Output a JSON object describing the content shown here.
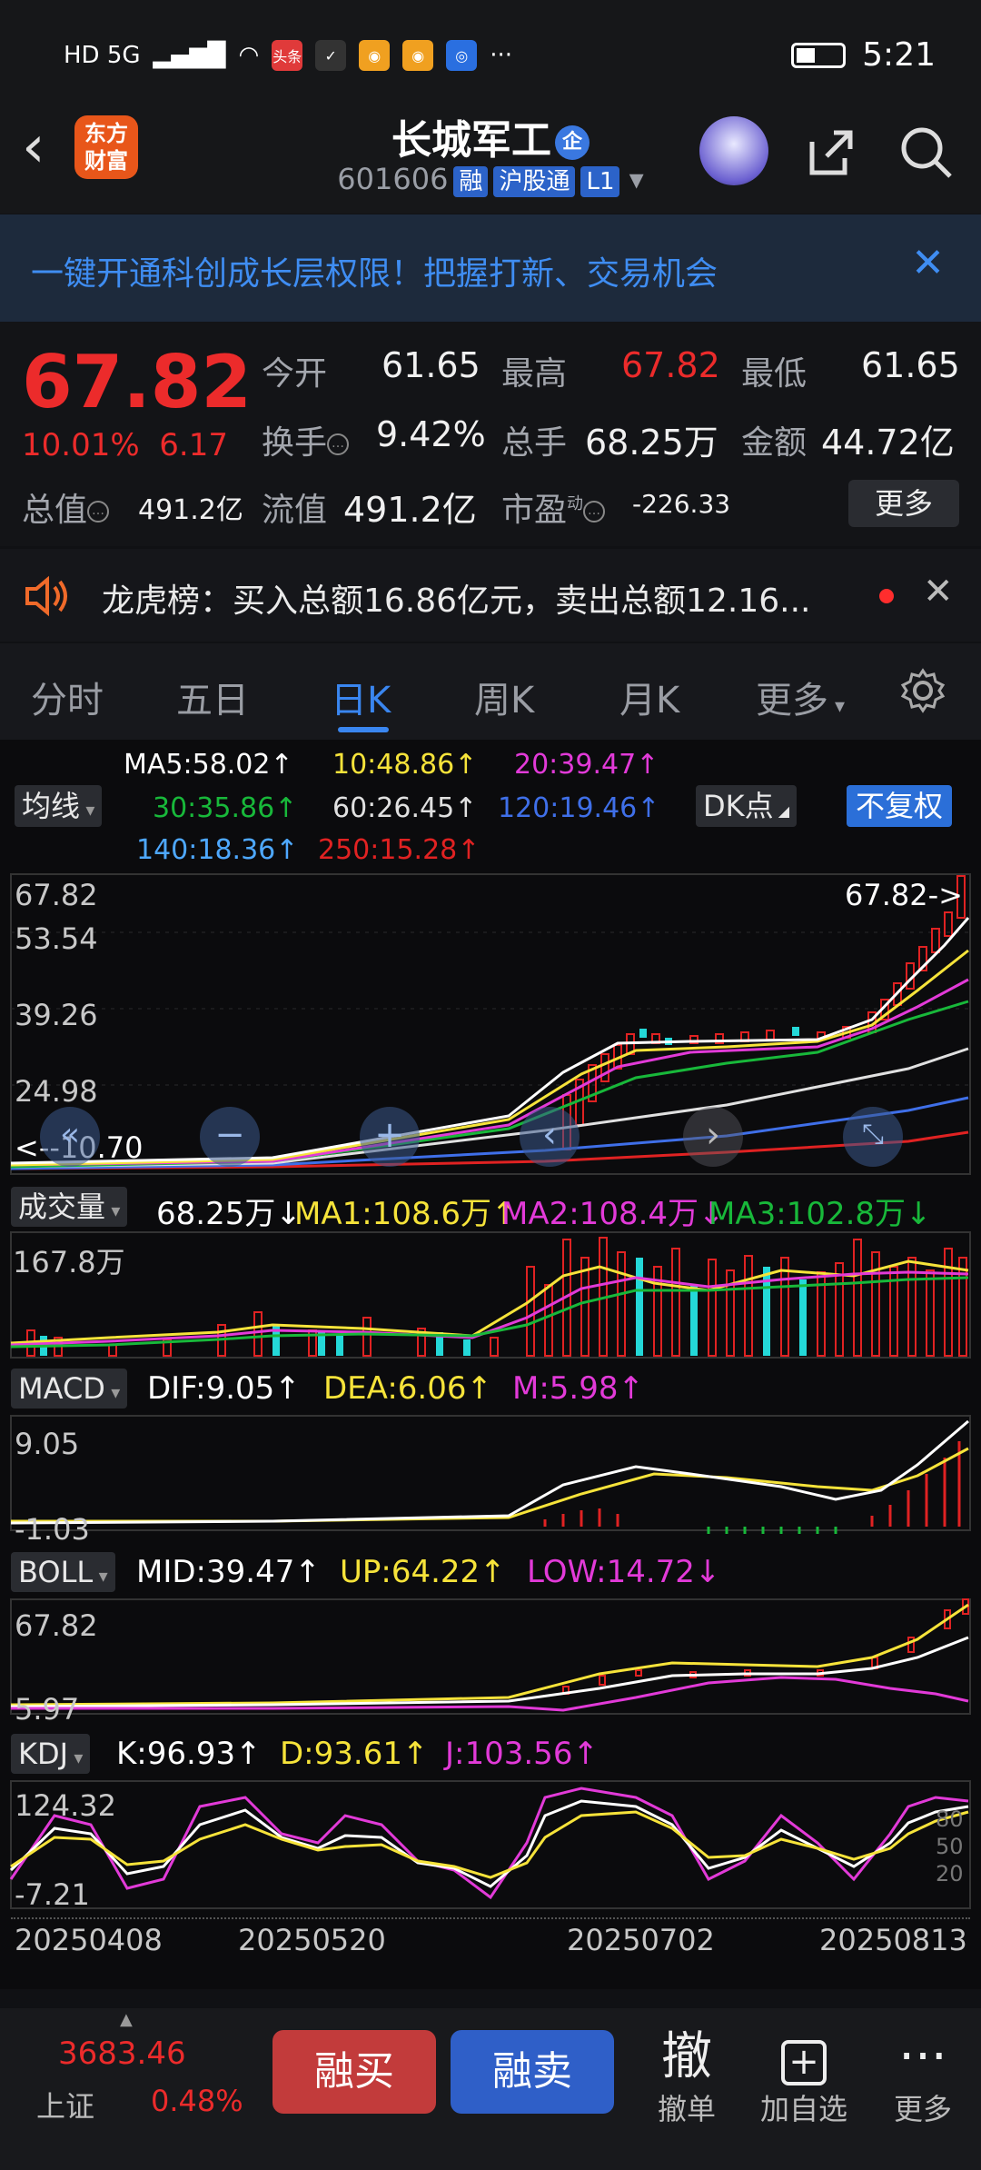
{
  "status_bar": {
    "network": "HD 5G",
    "time": "5:21",
    "more": "···",
    "app_badge": "头条"
  },
  "header": {
    "logo": "东方财富",
    "title": "长城军工",
    "title_badge": "企",
    "code": "601606",
    "tags": [
      "融",
      "沪股通",
      "L1"
    ]
  },
  "banner": {
    "text": "一键开通科创成长层权限！把握打新、交易机会",
    "close": "✕"
  },
  "quote": {
    "price": "67.82",
    "change_pct": "10.01%",
    "change": "6.17",
    "open_label": "今开",
    "open": "61.65",
    "high_label": "最高",
    "high": "67.82",
    "low_label": "最低",
    "low": "61.65",
    "turnover_label": "换手",
    "turnover": "9.42%",
    "volume_label": "总手",
    "volume": "68.25万",
    "amount_label": "金额",
    "amount": "44.72亿",
    "mcap_label": "总值",
    "mcap": "491.2亿",
    "float_label": "流值",
    "float": "491.2亿",
    "pe_label": "市盈",
    "pe_sup": "动",
    "pe": "-226.33",
    "more": "更多"
  },
  "notice": {
    "text": "龙虎榜：买入总额16.86亿元，卖出总额12.16...",
    "close": "✕"
  },
  "tabs": {
    "items": [
      "分时",
      "五日",
      "日K",
      "周K",
      "月K",
      "更多"
    ],
    "active": 2
  },
  "ma": {
    "selector": "均线",
    "ma5": "MA5:58.02↑",
    "ma10": "10:48.86↑",
    "ma20": "20:39.47↑",
    "ma30": "30:35.86↑",
    "ma60": "60:26.45↑",
    "ma120": "120:19.46↑",
    "ma140": "140:18.36↑",
    "ma250": "250:15.28↑",
    "dk_button": "DK点",
    "adjust_button": "不复权"
  },
  "kline": {
    "y_labels": [
      "67.82",
      "53.54",
      "39.26",
      "24.98",
      "10.70"
    ],
    "latest_label": "67.82->",
    "low_label": "<--10.70",
    "colors": {
      "ma5": "#ffffff",
      "ma10": "#f6e33a",
      "ma20": "#e23ad8",
      "ma30": "#18b83a",
      "ma60": "#e0e0e0",
      "ma120": "#3f6fe8",
      "ma250": "#e02222"
    }
  },
  "volume": {
    "selector": "成交量",
    "value": "68.25万↓",
    "ma1": "MA1:108.6万↑",
    "ma2": "MA2:108.4万↓",
    "ma3": "MA3:102.8万↓",
    "y_label": "167.8万"
  },
  "macd": {
    "selector": "MACD",
    "dif": "DIF:9.05↑",
    "dea": "DEA:6.06↑",
    "m": "M:5.98↑",
    "y_top": "9.05",
    "y_bottom": "-1.03"
  },
  "boll": {
    "selector": "BOLL",
    "mid": "MID:39.47↑",
    "up": "UP:64.22↑",
    "low": "LOW:14.72↓",
    "y_top": "67.82",
    "y_bottom": "5.97"
  },
  "kdj": {
    "selector": "KDJ",
    "k": "K:96.93↑",
    "d": "D:93.61↑",
    "j": "J:103.56↑",
    "y_top": "124.32",
    "y_bottom": "-7.21",
    "levels": [
      "80",
      "50",
      "20"
    ]
  },
  "dates": [
    "20250408",
    "20250520",
    "20250702",
    "20250813"
  ],
  "bottom": {
    "index_value": "3683.46",
    "index_name": "上证",
    "index_pct": "0.48%",
    "buy": "融买",
    "sell": "融卖",
    "cancel_icon": "撤",
    "cancel": "撤单",
    "add": "加自选",
    "more": "更多"
  }
}
